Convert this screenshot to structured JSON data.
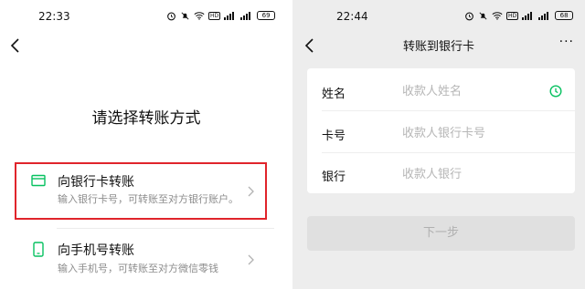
{
  "left_screen": {
    "status": {
      "time": "22:33",
      "battery": "69",
      "hd": "HD"
    },
    "title": "请选择转账方式",
    "options": [
      {
        "title": "向银行卡转账",
        "desc": "输入银行卡号，可转账至对方银行账户。",
        "icon": "bank-card-icon"
      },
      {
        "title": "向手机号转账",
        "desc": "输入手机号，可转账至对方微信零钱",
        "icon": "mobile-phone-icon"
      }
    ]
  },
  "right_screen": {
    "status": {
      "time": "22:44",
      "battery": "68",
      "hd": "HD"
    },
    "title": "转账到银行卡",
    "fields": [
      {
        "label": "姓名",
        "placeholder": "收款人姓名"
      },
      {
        "label": "卡号",
        "placeholder": "收款人银行卡号"
      },
      {
        "label": "银行",
        "placeholder": "收款人银行"
      }
    ],
    "next_button": "下一步",
    "more_label": "···"
  },
  "colors": {
    "highlight_border": "#e0242b",
    "wechat_green": "#07c160",
    "disabled_button": "#e0e0e0"
  }
}
